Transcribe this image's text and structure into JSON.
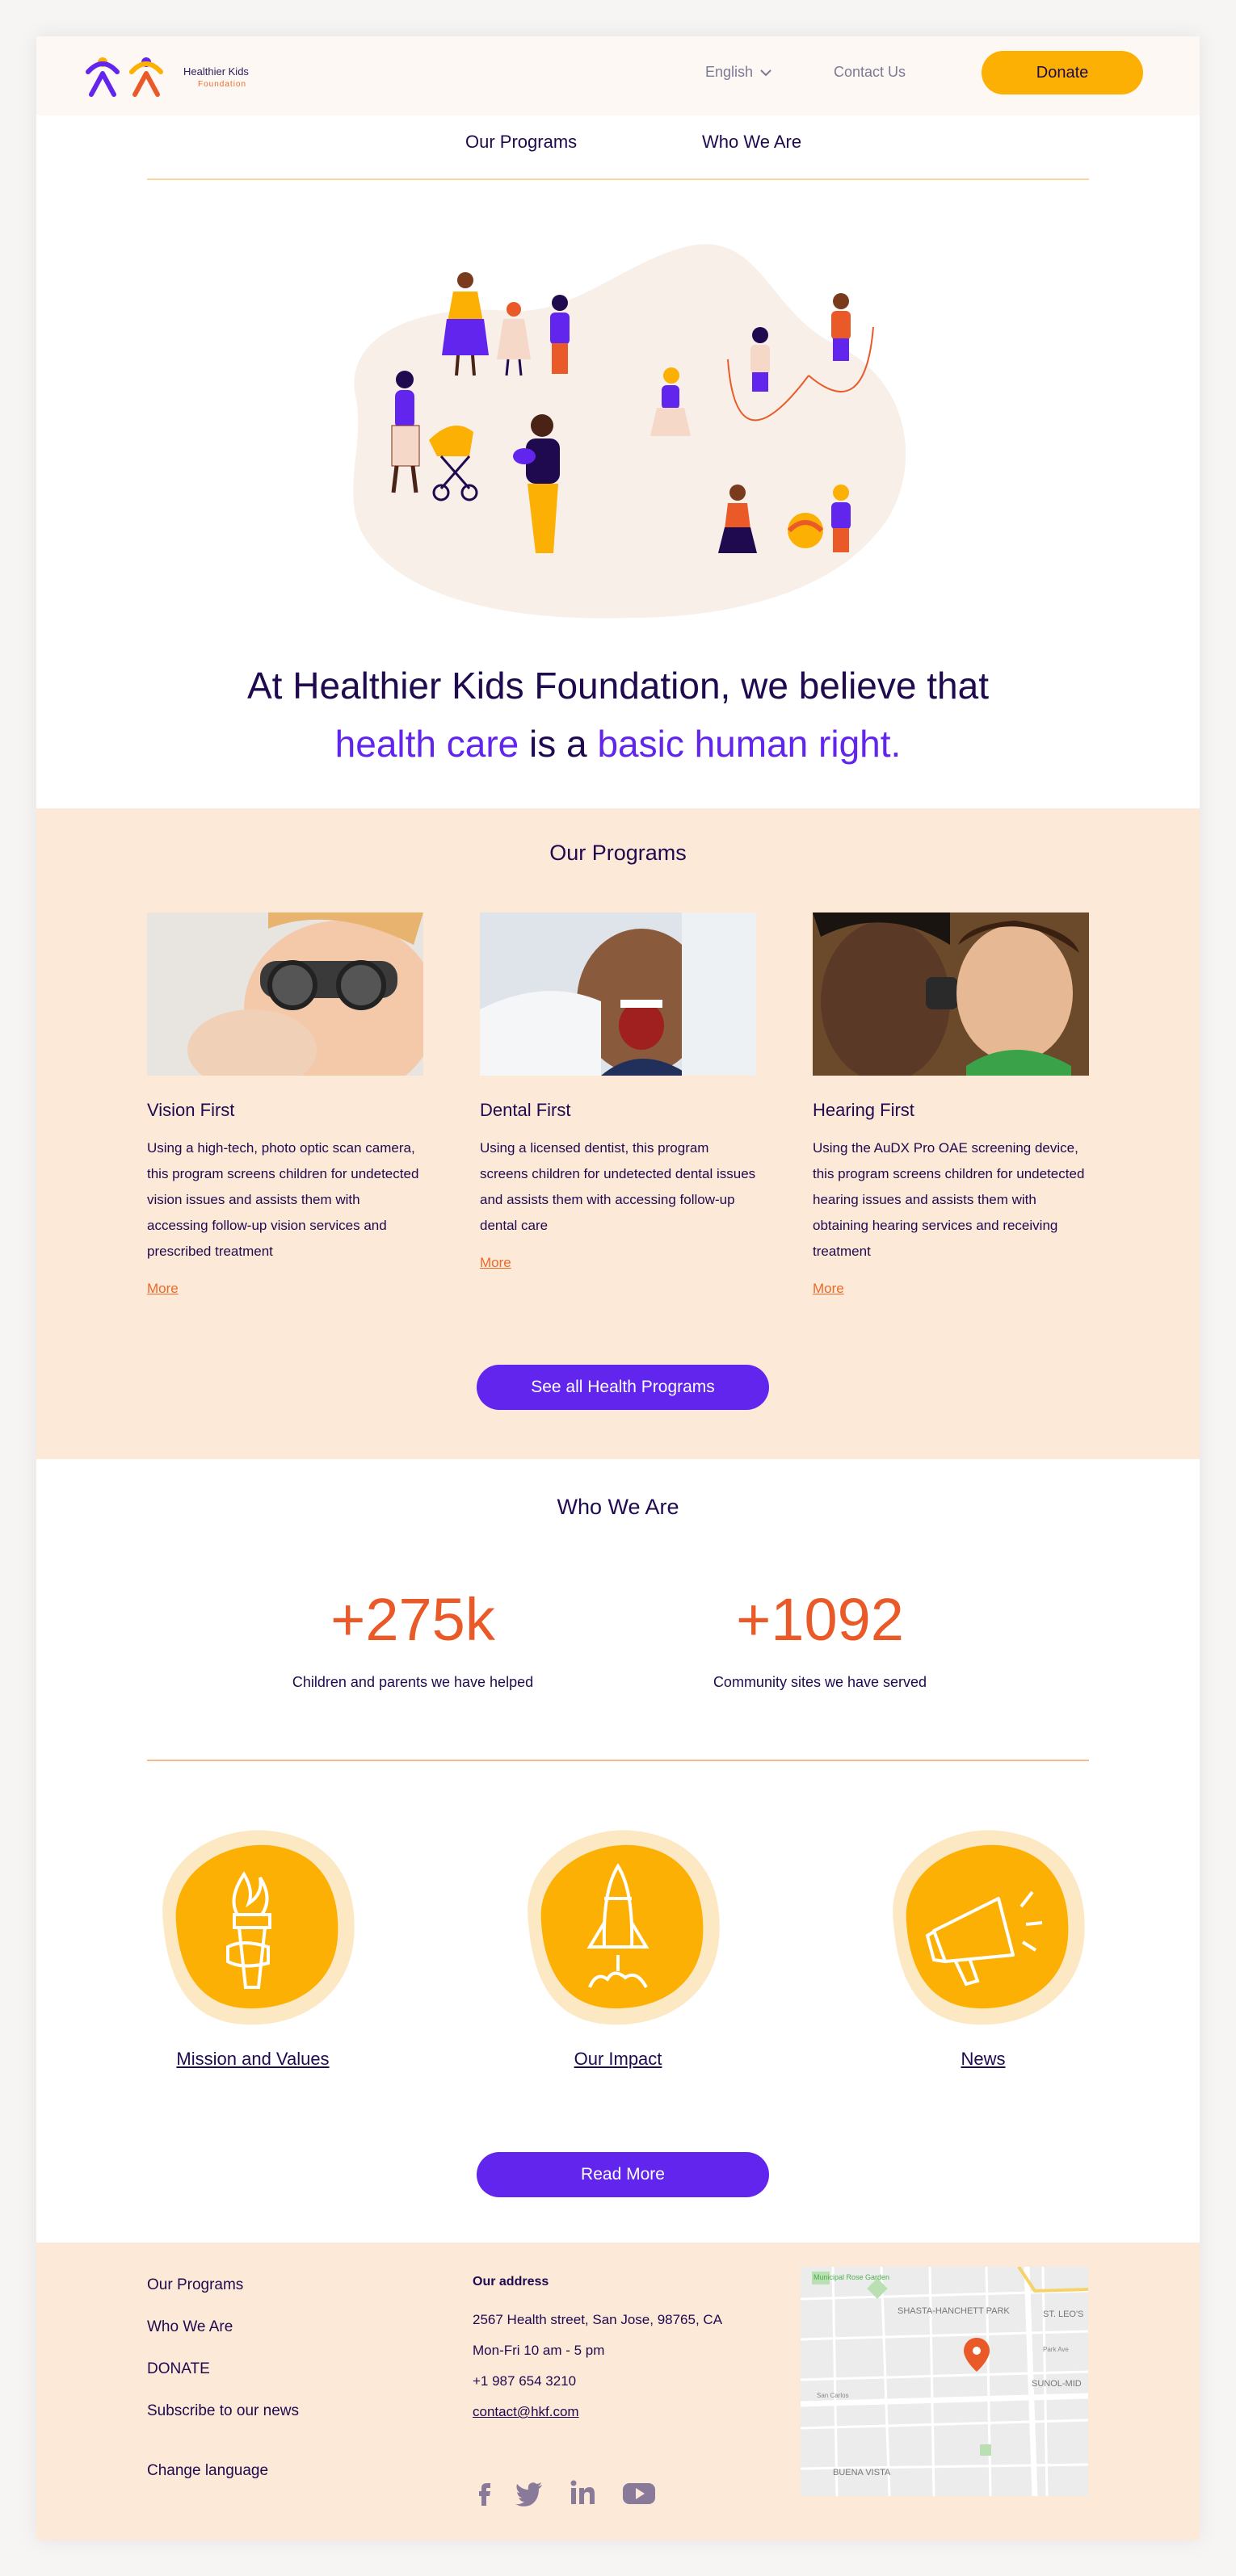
{
  "brand": {
    "name": "Healthier Kids",
    "sub": "Foundation"
  },
  "header": {
    "language": "English",
    "contact": "Contact Us",
    "donate": "Donate"
  },
  "nav": {
    "programs": "Our Programs",
    "who": "Who We Are"
  },
  "hero": {
    "line1": "At Healthier Kids Foundation, we believe that",
    "hl1": "health care",
    "mid": " is a ",
    "hl2": "basic human right."
  },
  "programs": {
    "title": "Our Programs",
    "cards": [
      {
        "title": "Vision First",
        "text": "Using a high-tech, photo optic scan camera, this program screens children for undetected vision issues and assists them with accessing follow-up vision services and prescribed treatment",
        "more": "More"
      },
      {
        "title": "Dental First",
        "text": "Using a licensed dentist, this program screens children for undetected dental issues and assists  them with accessing follow-up dental care",
        "more": "More"
      },
      {
        "title": "Hearing First",
        "text": "Using the AuDX Pro OAE screening device, this program screens children for undetected hearing issues and assists them with obtaining hearing services and receiving treatment",
        "more": "More"
      }
    ],
    "button": "See all Health Programs"
  },
  "who": {
    "title": "Who We Are",
    "stats": [
      {
        "value": "+275k",
        "label": "Children and parents we have helped"
      },
      {
        "value": "+1092",
        "label": "Community sites we have served"
      }
    ],
    "links": [
      "Mission and Values",
      "Our Impact",
      "News"
    ],
    "button": "Read More"
  },
  "footer": {
    "links": [
      "Our Programs",
      "Who We Are",
      "DONATE",
      "Subscribe to our news",
      "Change language"
    ],
    "address_title": "Our address",
    "address": "2567 Health street, San Jose, 98765, CA",
    "hours": "Mon-Fri  10 am - 5 pm",
    "phone": "+1 987 654 3210",
    "email": "contact@hkf.com",
    "map_labels": [
      "Municipal Rose Garden",
      "SHASTA-HANCHETT PARK",
      "ST. LEO'S",
      "SUNOL-MID",
      "BUENA VISTA",
      "Park Ave",
      "San Carlos"
    ]
  },
  "colors": {
    "accent": "#6225ee",
    "orange": "#ea5a28",
    "yellow": "#fcb004",
    "peach": "#fde9d8",
    "navy": "#1f0a4f"
  }
}
